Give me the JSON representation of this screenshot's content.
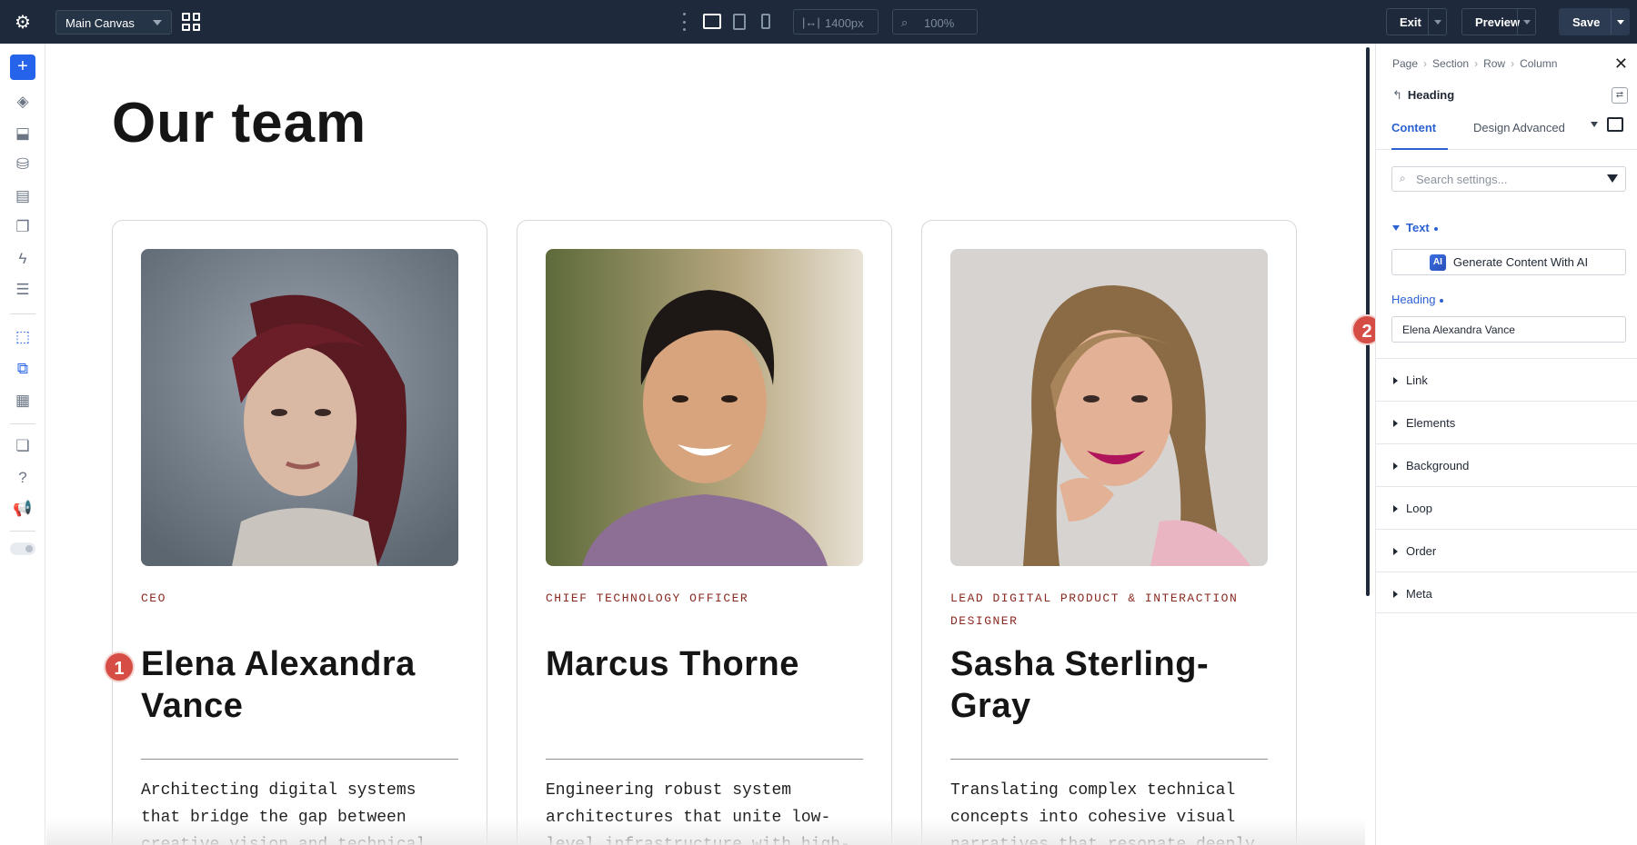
{
  "topbar": {
    "canvas_name": "Main Canvas",
    "width_value": "1400px",
    "zoom_value": "100%",
    "exit_label": "Exit",
    "preview_label": "Preview",
    "save_label": "Save"
  },
  "leftbar": {
    "icons": [
      "layers-icon",
      "paint-icon",
      "database-icon",
      "form-icon",
      "pages-icon",
      "bolt-icon",
      "list-icon",
      "select-icon",
      "multi-select-icon",
      "template-icon",
      "stack-icon",
      "help-icon",
      "megaphone-icon"
    ]
  },
  "canvas": {
    "title": "Our team",
    "cards": [
      {
        "role": "CEO",
        "name": "Elena Alexandra Vance",
        "description": "Architecting digital systems that bridge the gap between creative vision and technical feasibility"
      },
      {
        "role": "CHIEF TECHNOLOGY OFFICER",
        "name": "Marcus Thorne",
        "description": "Engineering robust system architectures that unite low-level infrastructure with high-level API"
      },
      {
        "role": "LEAD DIGITAL PRODUCT & INTERACTION DESIGNER",
        "name": "Sasha Sterling-Gray",
        "description": "Translating complex technical concepts into cohesive visual narratives that resonate deeply"
      }
    ],
    "markers": [
      "1",
      "2"
    ]
  },
  "panel": {
    "breadcrumbs": [
      "Page",
      "Section",
      "Row",
      "Column"
    ],
    "element_title": "Heading",
    "tabs": [
      "Content",
      "Design",
      "Advanced"
    ],
    "search_placeholder": "Search settings...",
    "text_section": "Text",
    "ai_button": "Generate Content With AI",
    "ai_badge": "AI",
    "heading_label": "Heading",
    "heading_value": "Elena Alexandra Vance",
    "sections": [
      "Link",
      "Elements",
      "Background",
      "Loop",
      "Order",
      "Meta"
    ]
  },
  "colors": {
    "topbar": "#1e2a3b",
    "accent": "#2563eb",
    "role_text": "#8a2a21",
    "marker": "#d64d45"
  }
}
